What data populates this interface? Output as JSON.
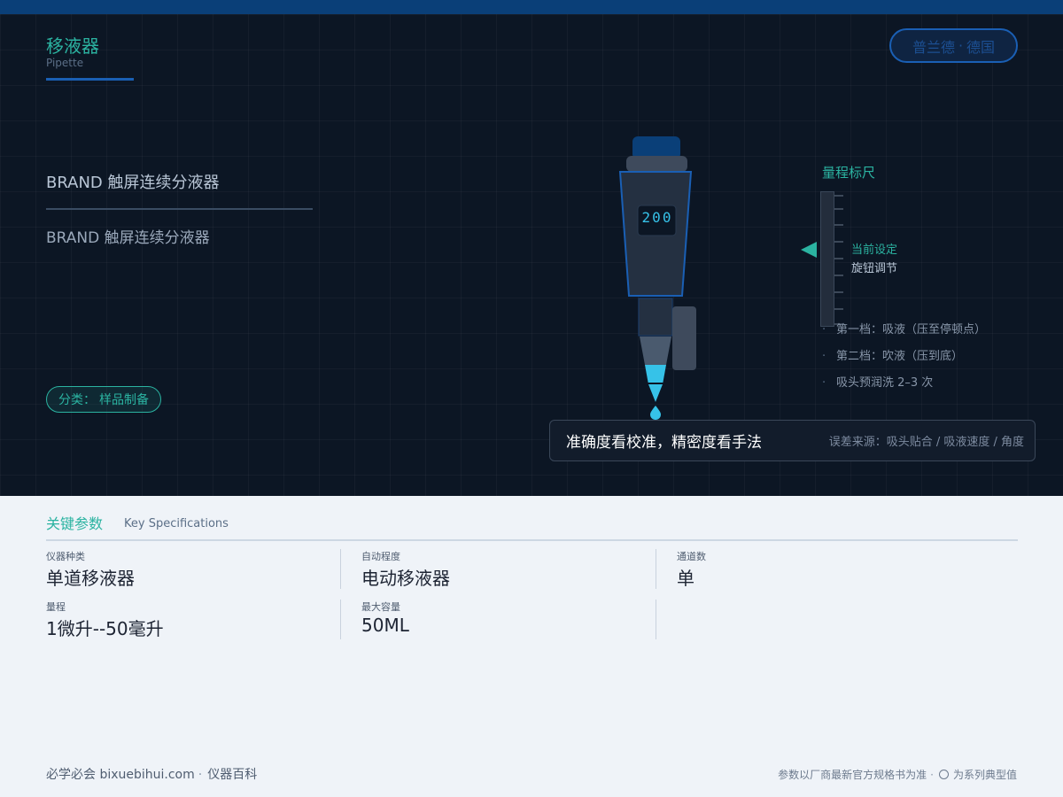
{
  "header": {
    "title_zh": "移液器",
    "title_en": "Pipette",
    "brand": "普兰德",
    "brand_sep": "·",
    "country": "德国"
  },
  "product": {
    "name_primary": "BRAND 触屏连续分液器",
    "name_secondary": "BRAND 触屏连续分液器",
    "category_label": "分类",
    "category_sep": "：",
    "category_value": "样品制备"
  },
  "pipette": {
    "display_value": "200"
  },
  "scale": {
    "title": "量程标尺",
    "current_label": "当前设定",
    "knob_label": "旋钮调节",
    "notes": [
      "第一档：吸液（压至停顿点）",
      "第二档：吹液（压到底）",
      "吸头预润洗 2–3 次"
    ]
  },
  "quote": {
    "main": "准确度看校准，精密度看手法",
    "sub": "误差来源：吸头贴合 / 吸液速度 / 角度"
  },
  "specs": {
    "title_zh": "关键参数",
    "title_en": "Key Specifications",
    "rows": [
      [
        {
          "label": "仪器种类",
          "value": "单道移液器"
        },
        {
          "label": "自动程度",
          "value": "电动移液器"
        },
        {
          "label": "通道数",
          "value": "单"
        }
      ],
      [
        {
          "label": "量程",
          "value": "1微升--50毫升"
        },
        {
          "label": "最大容量",
          "value": "50ML"
        },
        {
          "label": "",
          "value": ""
        }
      ]
    ]
  },
  "footer": {
    "site": "必学必会 bixuebihui.com",
    "sep": "·",
    "section": "仪器百科",
    "note": "参数以厂商最新官方规格书为准",
    "legend": "为系列典型值"
  },
  "colors": {
    "accent": "#2bb3a1",
    "brand_blue": "#1a5fb4",
    "hero_bg": "#0c1624",
    "page_bg": "#eff3f8"
  }
}
